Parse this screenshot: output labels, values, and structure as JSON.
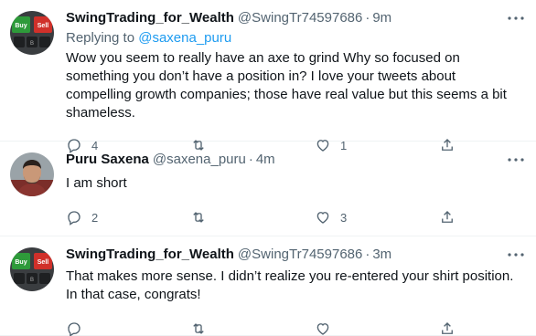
{
  "tweets": [
    {
      "name": "SwingTrading_for_Wealth",
      "handle": "@SwingTr74597686",
      "time": "9m",
      "replying_prefix": "Replying to",
      "replying_to": "@saxena_puru",
      "text": "Wow you seem to really have an axe to grind Why so focused on something you don’t have a position in? I love your tweets about compelling growth companies; those have real value but this seems a bit shameless.",
      "replies": "4",
      "retweets": "",
      "likes": "1",
      "avatar_icon": "buy-sell-keyboard-avatar"
    },
    {
      "name": "Puru Saxena",
      "handle": "@saxena_puru",
      "time": "4m",
      "text": "I am short",
      "replies": "2",
      "retweets": "",
      "likes": "3",
      "avatar_icon": "person-photo-avatar"
    },
    {
      "name": "SwingTrading_for_Wealth",
      "handle": "@SwingTr74597686",
      "time": "3m",
      "text": "That makes more sense. I didn’t realize you re-entered your shirt position. In that case, congrats!",
      "replies": "",
      "retweets": "",
      "likes": "",
      "avatar_icon": "buy-sell-keyboard-avatar"
    }
  ],
  "ui": {
    "dot": "·",
    "more": "•••"
  },
  "colors": {
    "link": "#1d9bf0",
    "secondary_text": "#536471",
    "buy_key": "#2e9a3a",
    "sell_key": "#d0302a"
  }
}
